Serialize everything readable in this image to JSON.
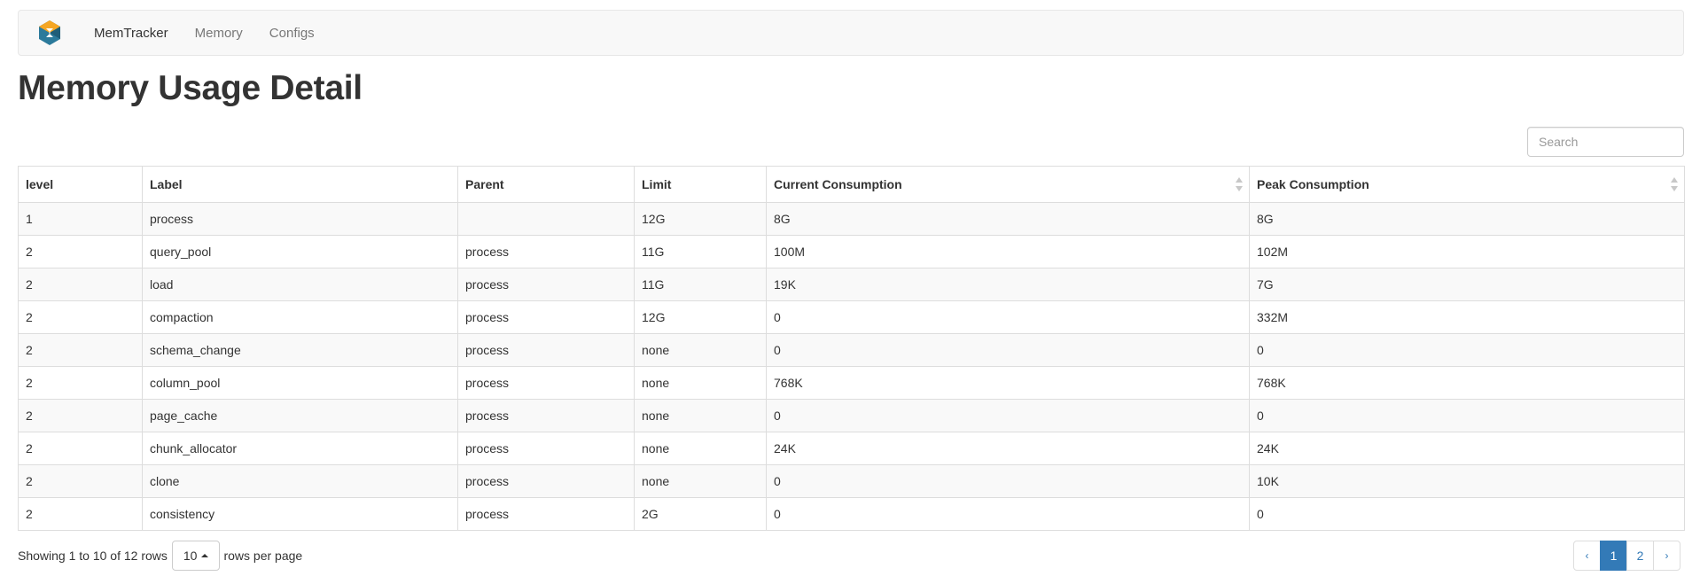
{
  "navbar": {
    "logo_icon": "memtracker-logo-icon",
    "brand": "MemTracker",
    "links": [
      "Memory",
      "Configs"
    ]
  },
  "page": {
    "title": "Memory Usage Detail"
  },
  "search": {
    "placeholder": "Search",
    "value": ""
  },
  "table": {
    "columns": [
      "level",
      "Label",
      "Parent",
      "Limit",
      "Current Consumption",
      "Peak Consumption"
    ],
    "sortable_columns": [
      "Current Consumption",
      "Peak Consumption"
    ],
    "rows": [
      [
        "1",
        "process",
        "",
        "12G",
        "8G",
        "8G"
      ],
      [
        "2",
        "query_pool",
        "process",
        "11G",
        "100M",
        "102M"
      ],
      [
        "2",
        "load",
        "process",
        "11G",
        "19K",
        "7G"
      ],
      [
        "2",
        "compaction",
        "process",
        "12G",
        "0",
        "332M"
      ],
      [
        "2",
        "schema_change",
        "process",
        "none",
        "0",
        "0"
      ],
      [
        "2",
        "column_pool",
        "process",
        "none",
        "768K",
        "768K"
      ],
      [
        "2",
        "page_cache",
        "process",
        "none",
        "0",
        "0"
      ],
      [
        "2",
        "chunk_allocator",
        "process",
        "none",
        "24K",
        "24K"
      ],
      [
        "2",
        "clone",
        "process",
        "none",
        "0",
        "10K"
      ],
      [
        "2",
        "consistency",
        "process",
        "2G",
        "0",
        "0"
      ]
    ]
  },
  "footer": {
    "showing_text": "Showing 1 to 10 of 12 rows",
    "page_size": "10",
    "rows_per_page_text": "rows per page"
  },
  "pagination": {
    "prev": "‹",
    "pages": [
      "1",
      "2"
    ],
    "active_page": "1",
    "next": "›"
  },
  "colors": {
    "navbar_bg": "#f8f8f8",
    "link": "#337ab7",
    "active_page_bg": "#337ab7",
    "stripe": "#f9f9f9",
    "logo_orange": "#f5a623",
    "logo_blue": "#1f6b8c"
  }
}
